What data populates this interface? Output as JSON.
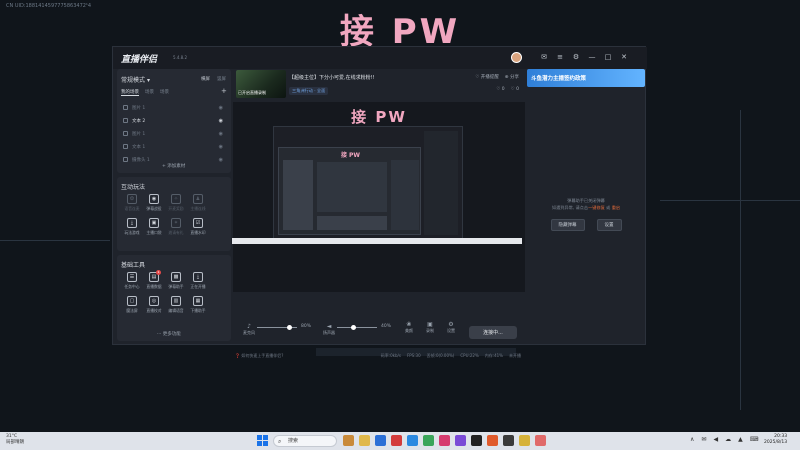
{
  "overlay": {
    "uid": "CN UID:1881414597775863472¹4",
    "big_title": "接 PW"
  },
  "app": {
    "logo": "直播伴侣",
    "version": "5.4.8.2",
    "window_controls": [
      "✉",
      "≡",
      "⚙",
      "—",
      "□",
      "✕"
    ]
  },
  "scene": {
    "mode": "常规模式",
    "mode_arrow": "▾",
    "actions": [
      "横屏",
      "竖屏"
    ],
    "tabs": [
      "我的场景",
      "场景",
      "场景"
    ],
    "add": "+",
    "sources": [
      {
        "label": "图片 1",
        "on": false
      },
      {
        "label": "文本 2",
        "on": true
      },
      {
        "label": "图片 1",
        "on": false
      },
      {
        "label": "文本 1",
        "on": false
      },
      {
        "label": "摄像头 1",
        "on": false
      }
    ],
    "add_source": "+ 添加素材"
  },
  "interactive": {
    "title": "互动玩法",
    "items": [
      {
        "label": "语音连麦",
        "icon": "❂",
        "dim": true
      },
      {
        "label": "弹幕战役",
        "icon": "◉",
        "dim": false
      },
      {
        "label": "开麦奖励",
        "icon": "✧",
        "dim": true
      },
      {
        "label": "主播连线",
        "icon": "♟",
        "dim": true
      },
      {
        "label": "",
        "icon": "",
        "dim": true
      },
      {
        "label": "玩法游戏",
        "icon": "⤓",
        "dim": false
      },
      {
        "label": "主播口袋",
        "icon": "▣",
        "dim": false
      },
      {
        "label": "邀请有礼",
        "icon": "✶",
        "dim": true
      },
      {
        "label": "直播水印",
        "icon": "☑",
        "dim": false
      },
      {
        "label": "",
        "icon": "",
        "dim": true
      }
    ]
  },
  "basic": {
    "title": "基础工具",
    "items": [
      {
        "label": "任务中心",
        "icon": "☰",
        "badge": ""
      },
      {
        "label": "直播数据",
        "icon": "▤",
        "badge": "1"
      },
      {
        "label": "弹幕助手",
        "icon": "▩",
        "badge": ""
      },
      {
        "label": "正在开播",
        "icon": "⤓",
        "badge": ""
      },
      {
        "label": "",
        "icon": "",
        "badge": ""
      },
      {
        "label": "魔法屏",
        "icon": "▢",
        "badge": ""
      },
      {
        "label": "直播校对",
        "icon": "◎",
        "badge": ""
      },
      {
        "label": "编辑语音",
        "icon": "▥",
        "badge": ""
      },
      {
        "label": "下播助手",
        "icon": "▦",
        "badge": ""
      },
      {
        "label": "",
        "icon": "",
        "badge": ""
      }
    ],
    "more": "··· 更多功能"
  },
  "stream": {
    "thumb_text": "已开启直播录制",
    "title": "【超级主位】下分小可爱,在线求粉粉!!",
    "category": "三角洲行动 · 全面",
    "follow": "♡ 开播提醒",
    "share": "⊕ 分享",
    "likes": "♡ 0",
    "hot": "♡ 0"
  },
  "preview": {
    "title": "接 PW",
    "inner_title": "接 PW"
  },
  "controls": {
    "mic_label": "麦克风",
    "mic_pct": "80%",
    "mic_level": 0.8,
    "speaker_label": "扬声器",
    "speaker_pct": "40%",
    "speaker_level": 0.4,
    "beauty": "美颜",
    "record": "录制",
    "settings": "设置",
    "live_button": "连接中...",
    "mic_icon": "♪",
    "speaker_icon": "◄",
    "beauty_icon": "❀",
    "record_icon": "▣",
    "settings_icon": "⚙"
  },
  "status": {
    "help": "❓ 如何快速上手直播伴侣?",
    "bitrate": "码率:0kb/s",
    "fps": "FPS:30",
    "drop": "丢帧:0(0.00%)",
    "cpu": "CPU:22%",
    "mem": "内存:41%",
    "quality": "未开播"
  },
  "right": {
    "banner": "斗鱼潜力主播签约政策",
    "msg1": "弹幕助手已关闭弹幕",
    "msg2": "如遇到异常, 请点击",
    "msg_link1": "一键修复",
    "msg_or": "或",
    "msg_link2": "重启",
    "btn1": "隐藏弹幕",
    "btn2": "设置"
  },
  "taskbar": {
    "weather_temp": "31°C",
    "weather_desc": "局部晴朗",
    "search": "搜索",
    "search_icon": "⌕",
    "tray": [
      "∧",
      "✉",
      "◀",
      "☁",
      "▲",
      "⌨"
    ],
    "time": "20:33",
    "date": "2025/8/13",
    "app_colors": [
      "#c98a3a",
      "#e0b84a",
      "#2b6fd6",
      "#d33b3b",
      "#2b89e0",
      "#3aa55a",
      "#d63b6f",
      "#7a4ad6",
      "#222222",
      "#e05a2b",
      "#3a3a3a",
      "#d6b23a",
      "#e06a6a"
    ]
  },
  "colors": {
    "accent_pink": "#f1a7c0",
    "banner_blue": "#2f7fd8",
    "link_orange": "#e06a3a"
  }
}
